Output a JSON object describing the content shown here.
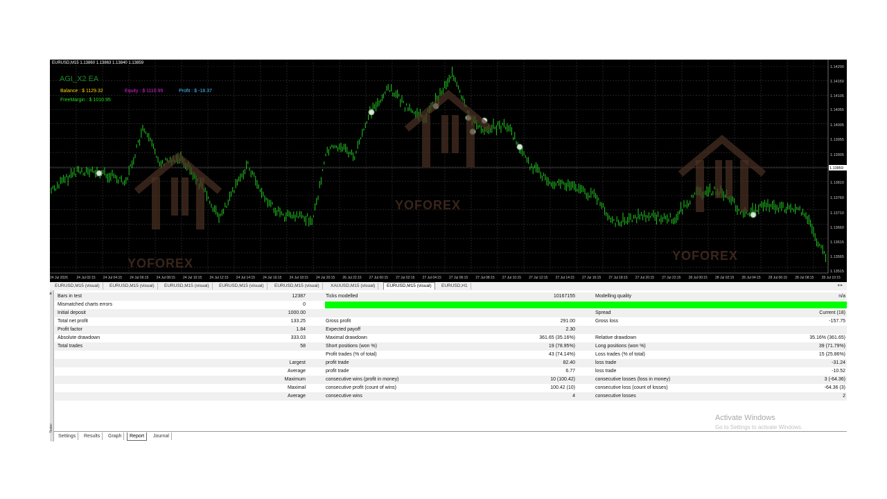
{
  "chart": {
    "header": "EURUSD,M15  1.13860 1.13863 1.13840 1.13859",
    "ea_name": "AGI_X2 EA",
    "balance": "Balance : $ 1129.32",
    "equity": "Equity : $ 1110.95",
    "profit": "Profit : $ -18.37",
    "free_margin": "FreeMargin : $ 1010.95",
    "price_levels": [
      "1.14200",
      "1.14150",
      "1.14105",
      "1.14055",
      "1.14005",
      "1.13955",
      "1.13905",
      "1.13859",
      "1.13810",
      "1.13760",
      "1.13710",
      "1.13660",
      "1.13615",
      "1.13565",
      "1.13515"
    ],
    "current_price": "1.13859",
    "time_labels": [
      "24 Jul 2026",
      "24 Jul 02:15",
      "24 Jul 04:15",
      "24 Jul 06:15",
      "24 Jul 08:15",
      "24 Jul 10:15",
      "24 Jul 12:15",
      "24 Jul 14:15",
      "24 Jul 16:15",
      "24 Jul 18:15",
      "24 Jul 20:15",
      "26 Jul 22:15",
      "27 Jul 00:15",
      "27 Jul 02:15",
      "27 Jul 04:15",
      "27 Jul 06:15",
      "27 Jul 08:15",
      "27 Jul 10:15",
      "27 Jul 12:15",
      "27 Jul 14:15",
      "27 Jul 16:15",
      "27 Jul 18:15",
      "27 Jul 20:15",
      "27 Jul 22:15",
      "28 Jul 00:15",
      "28 Jul 02:15",
      "28 Jul 04:15",
      "28 Jul 06:15",
      "28 Jul 08:15",
      "28 Jul 10:15"
    ],
    "watermark": "YOFOREX",
    "colors": {
      "candle": "#22cc22",
      "grid": "#3a3a3a",
      "background": "#000000"
    }
  },
  "chart_tabs": [
    {
      "label": "EURUSD,M15 (visual)"
    },
    {
      "label": "EURUSD,M15 (visual)"
    },
    {
      "label": "EURUSD,M15 (visual)"
    },
    {
      "label": "EURUSD,M15 (visual)"
    },
    {
      "label": "EURUSD,M15 (visual)"
    },
    {
      "label": "XAUUSD,M15 (visual)"
    },
    {
      "label": "EURUSD,M15 (visual)"
    },
    {
      "label": "EURUSD,H1"
    }
  ],
  "report": {
    "bars_in_test": {
      "label": "Bars in test",
      "value": "12387"
    },
    "ticks_modelled": {
      "label": "Ticks modelled",
      "value": "10167155"
    },
    "modelling_quality": {
      "label": "Modelling quality",
      "value": "n/a"
    },
    "mismatched": {
      "label": "Mismatched charts errors",
      "value": "0"
    },
    "initial_deposit": {
      "label": "Initial deposit",
      "value": "1000.00"
    },
    "spread": {
      "label": "Spread",
      "value": "Current (18)"
    },
    "total_net_profit": {
      "label": "Total net profit",
      "value": "133.25"
    },
    "gross_profit": {
      "label": "Gross profit",
      "value": "291.00"
    },
    "gross_loss": {
      "label": "Gross loss",
      "value": "-157.75"
    },
    "profit_factor": {
      "label": "Profit factor",
      "value": "1.84"
    },
    "expected_payoff": {
      "label": "Expected payoff",
      "value": "2.30"
    },
    "absolute_drawdown": {
      "label": "Absolute drawdown",
      "value": "333.03"
    },
    "maximal_drawdown": {
      "label": "Maximal drawdown",
      "value": "361.65 (35.16%)"
    },
    "relative_drawdown": {
      "label": "Relative drawdown",
      "value": "35.16% (361.65)"
    },
    "total_trades": {
      "label": "Total trades",
      "value": "58"
    },
    "short_positions": {
      "label": "Short positions (won %)",
      "value": "19 (78.95%)"
    },
    "long_positions": {
      "label": "Long positions (won %)",
      "value": "39 (71.79%)"
    },
    "profit_trades": {
      "label": "Profit trades (% of total)",
      "value": "43 (74.14%)"
    },
    "loss_trades": {
      "label": "Loss trades (% of total)",
      "value": "15 (25.86%)"
    },
    "rows": [
      {
        "prefix": "Largest",
        "l_label": "profit trade",
        "l_value": "82.40",
        "r_label": "loss trade",
        "r_value": "-31.24"
      },
      {
        "prefix": "Average",
        "l_label": "profit trade",
        "l_value": "6.77",
        "r_label": "loss trade",
        "r_value": "-10.52"
      },
      {
        "prefix": "Maximum",
        "l_label": "consecutive wins (profit in money)",
        "l_value": "10 (100.42)",
        "r_label": "consecutive losses (loss in money)",
        "r_value": "3 (-64.36)"
      },
      {
        "prefix": "Maximal",
        "l_label": "consecutive profit (count of wins)",
        "l_value": "100.42 (10)",
        "r_label": "consecutive loss (count of losses)",
        "r_value": "-64.36 (3)"
      },
      {
        "prefix": "Average",
        "l_label": "consecutive wins",
        "l_value": "4",
        "r_label": "consecutive losses",
        "r_value": "2"
      }
    ],
    "quality_bar_color": "#00ff00"
  },
  "bottom_tabs": [
    {
      "label": "Settings"
    },
    {
      "label": "Results"
    },
    {
      "label": "Graph"
    },
    {
      "label": "Report"
    },
    {
      "label": "Journal"
    }
  ],
  "tester_label": "Tester",
  "activate": {
    "title": "Activate Windows",
    "subtitle": "Go to Settings to activate Windows."
  }
}
